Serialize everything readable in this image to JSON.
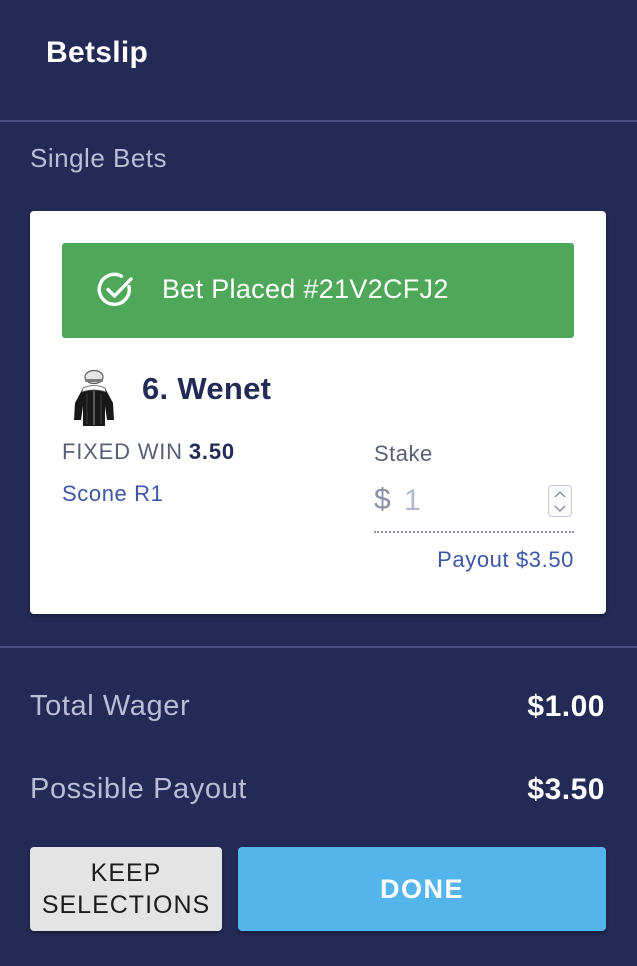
{
  "header": {
    "title": "Betslip"
  },
  "section": {
    "label": "Single Bets"
  },
  "bet": {
    "status": "Bet Placed #21V2CFJ2",
    "runner": "6. Wenet",
    "bet_type": "FIXED WIN",
    "odds": "3.50",
    "race": "Scone R1",
    "stake_label": "Stake",
    "currency": "$",
    "stake_value": "1",
    "payout": "Payout $3.50"
  },
  "summary": {
    "total_wager_label": "Total Wager",
    "total_wager_value": "$1.00",
    "possible_payout_label": "Possible Payout",
    "possible_payout_value": "$3.50"
  },
  "actions": {
    "keep_selections_line1": "KEEP",
    "keep_selections_line2": "SELECTIONS",
    "done_label": "DONE"
  },
  "icons": {
    "status": "check-circle-icon",
    "silks": "jockey-silks-icon",
    "stepper_up": "chevron-up-icon",
    "stepper_down": "chevron-down-icon"
  },
  "colors": {
    "background": "#232a55",
    "success": "#4fa85a",
    "primary_button": "#54b4ec",
    "secondary_button": "#e4e4e4",
    "link": "#3d56a8"
  }
}
